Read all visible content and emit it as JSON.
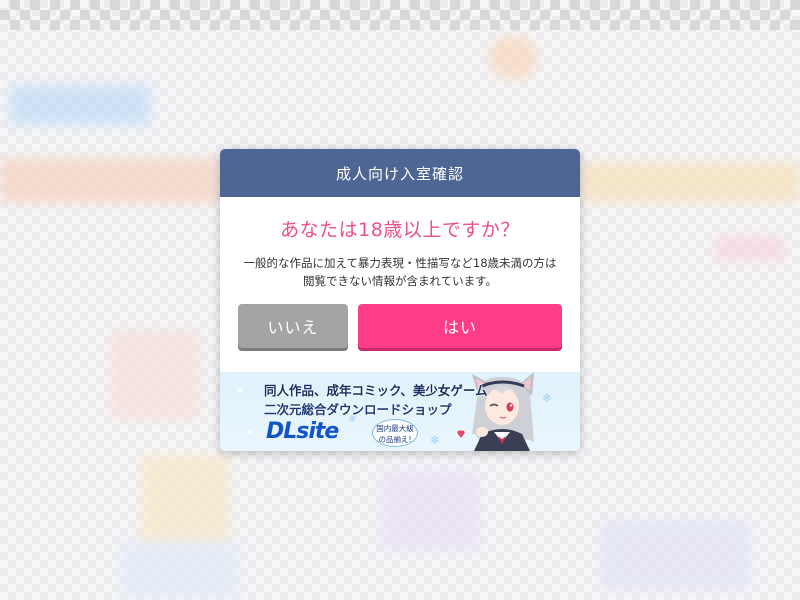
{
  "dialog": {
    "title": "成人向け入室確認",
    "question": "あなたは18歳以上ですか？",
    "description_line1": "一般的な作品に加えて暴力表現・性描写など18歳未満の方は",
    "description_line2": "閲覧できない情報が含まれています。",
    "no_label": "いいえ",
    "yes_label": "はい"
  },
  "banner": {
    "line1": "同人作品、成年コミック、美少女ゲーム",
    "line2": "二次元総合ダウンロードショップ",
    "logo_text": "DLsite",
    "badge_line1": "国内最大級",
    "badge_line2": "の品揃え!"
  },
  "colors": {
    "header_bg": "#4e6694",
    "question_text": "#ec4f8d",
    "yes_button": "#fe3d86",
    "no_button": "#a4a4a4"
  }
}
